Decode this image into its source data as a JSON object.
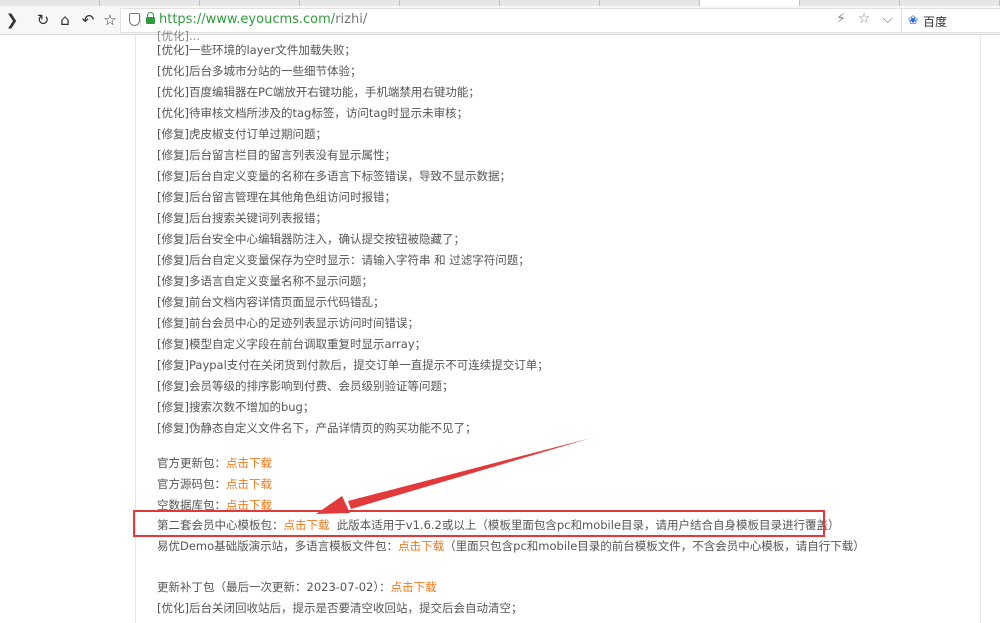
{
  "browser": {
    "url_host": "https://www.eyoucms.com/",
    "url_path": "rizhi/",
    "search_engine": "百度",
    "icons": [
      "back-icon",
      "reload-icon",
      "home-icon",
      "undo-icon",
      "star-icon",
      "shield-icon",
      "lock-icon",
      "bolt-icon",
      "favorite-icon",
      "dropdown-icon",
      "baidu-paw-icon"
    ]
  },
  "changelog": [
    "[优化]一些环境的layer文件加载失败；",
    "[优化]后台多城市分站的一些细节体验；",
    "[优化]百度编辑器在PC端放开右键功能，手机端禁用右键功能；",
    "[优化]待审核文档所涉及的tag标签，访问tag时显示未审核；",
    "[修复]虎皮椒支付订单过期问题；",
    "[修复]后台留言栏目的留言列表没有显示属性；",
    "[修复]后台自定义变量的名称在多语言下标签错误，导致不显示数据；",
    "[修复]后台留言管理在其他角色组访问时报错；",
    "[修复]后台搜索关键词列表报错；",
    "[修复]后台安全中心编辑器防注入，确认提交按钮被隐藏了；",
    "[修复]后台自定义变量保存为空时显示：请输入字符串 和 过滤字符问题；",
    "[修复]多语言自定义变量名称不显示问题；",
    "[修复]前台文档内容详情页面显示代码错乱；",
    "[修复]前台会员中心的足迹列表显示访问时间错误；",
    "[修复]模型自定义字段在前台调取重复时显示array；",
    "[修复]Paypal支付在关闭货到付款后，提交订单一直提示不可连续提交订单；",
    "[修复]会员等级的排序影响到付费、会员级别验证等问题；",
    "[修复]搜索次数不增加的bug；",
    "[修复]伪静态自定义文件名下，产品详情页的购买功能不见了；"
  ],
  "downloads": {
    "official_update": {
      "label": "官方更新包：",
      "link": "点击下载"
    },
    "official_source": {
      "label": "官方源码包：",
      "link": "点击下载"
    },
    "empty_db": {
      "label": "空数据库包：",
      "link": "点击下载"
    },
    "member_template": {
      "label": "第二套会员中心模板包：",
      "link": "点击下载",
      "note": "此版本适用于v1.6.2或以上（模板里面包含pc和mobile目录，请用户结合自身模板目录进行覆盖）"
    },
    "demo_site": {
      "label": "易优Demo基础版演示站，多语言模板文件包：",
      "link": "点击下载",
      "note": "（里面只包含pc和mobile目录的前台模板文件，不含会员中心模板，请自行下载）"
    },
    "patch": {
      "label": "更新补丁包（最后一次更新：2023-07-02）：",
      "link": "点击下载"
    }
  },
  "last_line": "[优化]后台关闭回收站后，提示是否要清空收回站，提交后会自动清空；",
  "colors": {
    "link": "#f07a1e",
    "annotation": "#e23a3a",
    "text": "#555555"
  }
}
